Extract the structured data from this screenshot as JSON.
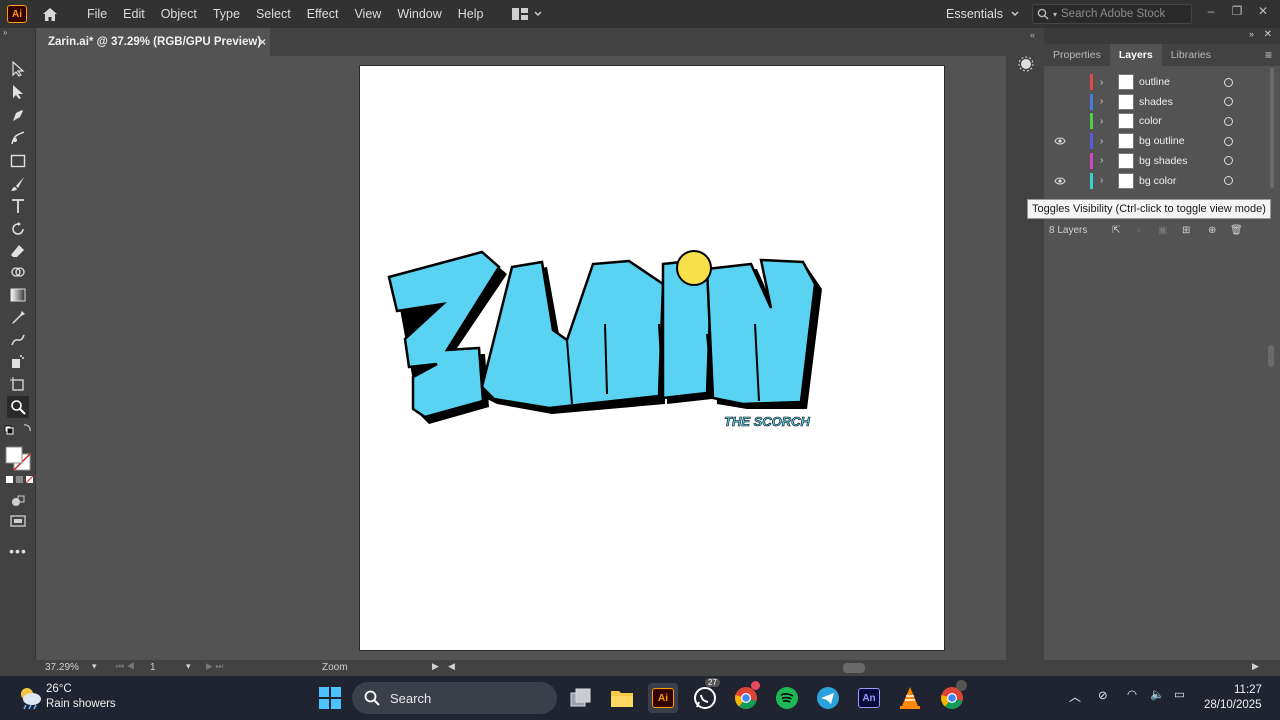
{
  "app": {
    "logo": "Ai"
  },
  "menu": {
    "items": [
      "File",
      "Edit",
      "Object",
      "Type",
      "Select",
      "Effect",
      "View",
      "Window",
      "Help"
    ]
  },
  "workspace": {
    "label": "Essentials"
  },
  "stock_search": {
    "placeholder": "Search Adobe Stock"
  },
  "document": {
    "tab_title": "Zarin.ai* @ 37.29% (RGB/GPU Preview)",
    "close": "×"
  },
  "artwork": {
    "main_text": "ZARiN",
    "sub_text": "THE SCORCH",
    "fill": "#5ad2f2",
    "outline": "#000000",
    "dot": "#f7e04a"
  },
  "panel": {
    "tabs": [
      "Properties",
      "Layers",
      "Libraries"
    ],
    "active_tab": "Layers",
    "layers": [
      {
        "name": "outline",
        "color": "#e04848",
        "visible": false
      },
      {
        "name": "shades",
        "color": "#4a7ae0",
        "visible": false
      },
      {
        "name": "color",
        "color": "#4ad04a",
        "visible": false
      },
      {
        "name": "bg outline",
        "color": "#5a5ae0",
        "visible": true
      },
      {
        "name": "bg shades",
        "color": "#d048c0",
        "visible": false
      },
      {
        "name": "bg color",
        "color": "#38d0d0",
        "visible": true
      }
    ],
    "layer_count": "8 Layers",
    "tooltip": "Toggles Visibility (Ctrl-click to toggle view mode)"
  },
  "status": {
    "zoom": "37.29%",
    "artboard": "1",
    "tool": "Zoom"
  },
  "taskbar": {
    "weather_temp": "26°C",
    "weather_desc": "Rain showers",
    "search_label": "Search",
    "time": "11:27",
    "date": "28/10/2025",
    "whatsapp_badge": "27"
  }
}
